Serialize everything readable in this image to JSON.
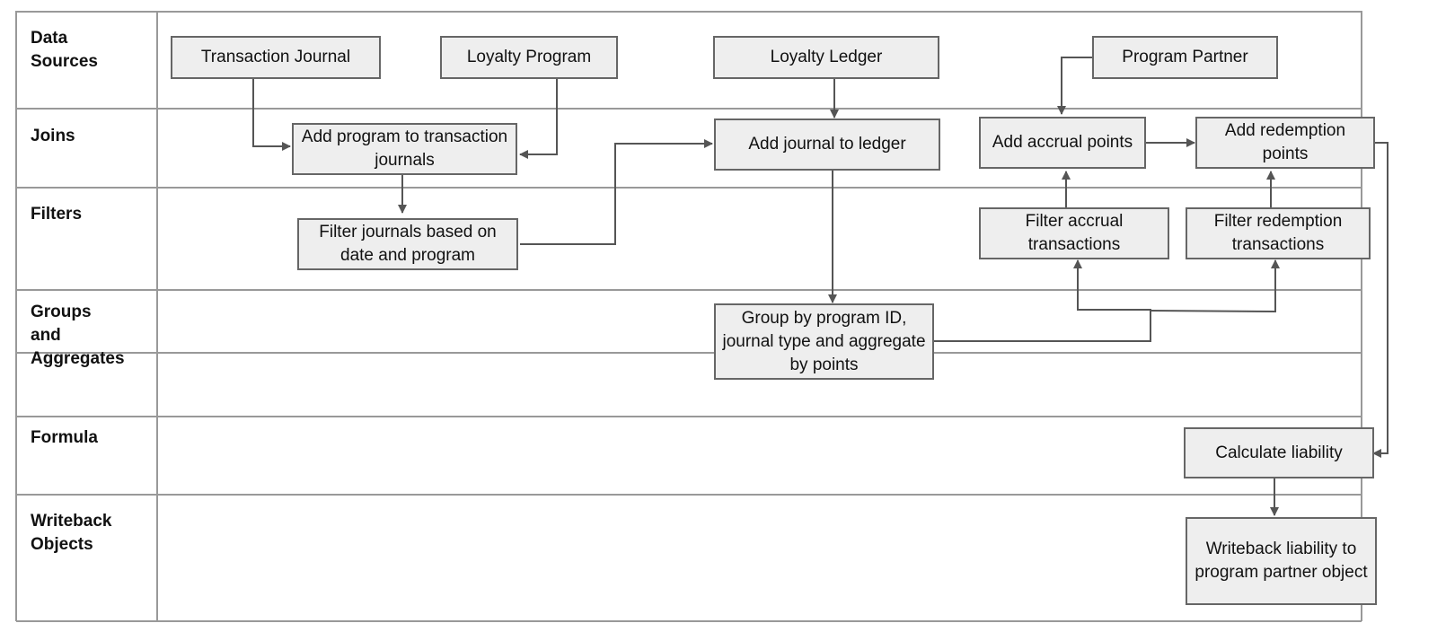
{
  "lanes": [
    {
      "id": "data_sources",
      "label": "Data\nSources"
    },
    {
      "id": "joins",
      "label": "Joins"
    },
    {
      "id": "filters",
      "label": "Filters"
    },
    {
      "id": "groups",
      "label": "Groups\nand\nAggregates"
    },
    {
      "id": "formula",
      "label": "Formula"
    },
    {
      "id": "writeback",
      "label": "Writeback\nObjects"
    }
  ],
  "nodes": {
    "transaction_journal": "Transaction Journal",
    "loyalty_program": "Loyalty Program",
    "loyalty_ledger": "Loyalty Ledger",
    "program_partner": "Program Partner",
    "add_program": "Add program to transaction journals",
    "add_journal": "Add journal to ledger",
    "add_accrual": "Add accrual points",
    "add_redemption": "Add redemption points",
    "filter_journals": "Filter journals based on date and program",
    "filter_accrual": "Filter accrual transactions",
    "filter_redemption": "Filter redemption transactions",
    "group_by": "Group by program ID, journal type and aggregate by points",
    "calc_liability": "Calculate liability",
    "writeback_liability": "Writeback liability to program partner object"
  },
  "edges": [
    {
      "from": "transaction_journal",
      "to": "add_program"
    },
    {
      "from": "loyalty_program",
      "to": "add_program"
    },
    {
      "from": "add_program",
      "to": "filter_journals"
    },
    {
      "from": "filter_journals",
      "to": "add_journal"
    },
    {
      "from": "loyalty_ledger",
      "to": "add_journal"
    },
    {
      "from": "add_journal",
      "to": "group_by"
    },
    {
      "from": "group_by",
      "to": "filter_accrual"
    },
    {
      "from": "group_by",
      "to": "filter_redemption"
    },
    {
      "from": "filter_accrual",
      "to": "add_accrual"
    },
    {
      "from": "filter_redemption",
      "to": "add_redemption"
    },
    {
      "from": "program_partner",
      "to": "add_accrual"
    },
    {
      "from": "add_accrual",
      "to": "add_redemption"
    },
    {
      "from": "add_redemption",
      "to": "calc_liability"
    },
    {
      "from": "calc_liability",
      "to": "writeback_liability"
    }
  ]
}
